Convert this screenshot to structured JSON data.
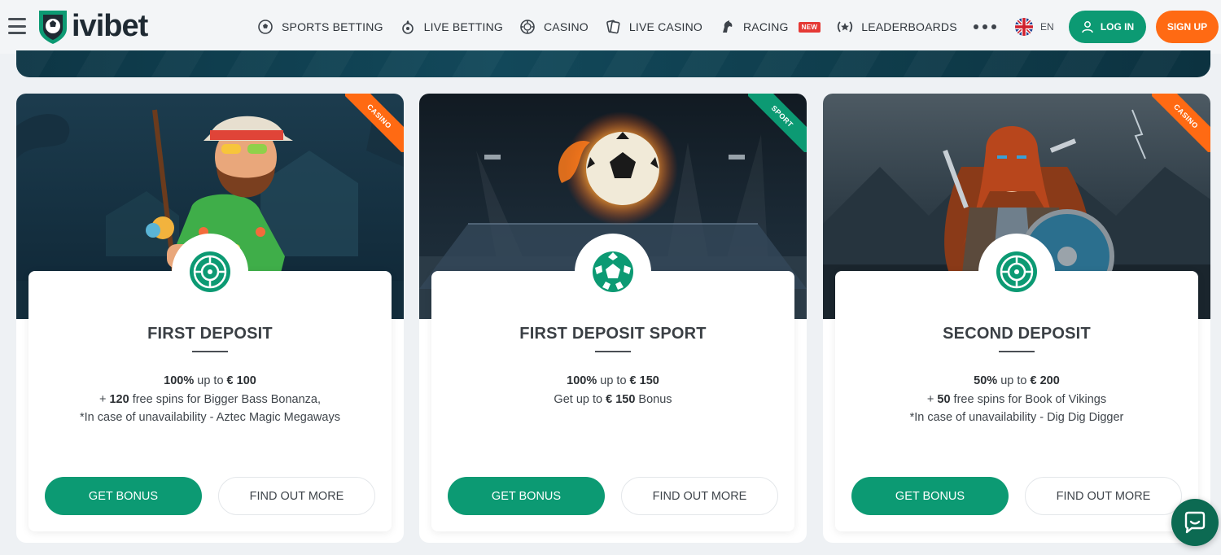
{
  "header": {
    "logo_text": "ivibet",
    "nav": [
      {
        "label": "SPORTS BETTING",
        "icon": "soccer-ball-icon"
      },
      {
        "label": "LIVE BETTING",
        "icon": "live-ball-icon"
      },
      {
        "label": "CASINO",
        "icon": "casino-chip-icon"
      },
      {
        "label": "LIVE CASINO",
        "icon": "cards-icon"
      },
      {
        "label": "RACING",
        "icon": "horse-icon",
        "badge": "NEW"
      },
      {
        "label": "LEADERBOARDS",
        "icon": "laurel-icon"
      }
    ],
    "language": "EN",
    "login_label": "LOG IN",
    "signup_label": "SIGN UP"
  },
  "colors": {
    "brand_green": "#0c9a73",
    "signup_orange": "#ff6a13",
    "ribbon_casino": "#ff6a13",
    "ribbon_sport": "#0c9a73",
    "badge_new": "#e53935"
  },
  "cards": [
    {
      "ribbon": "CASINO",
      "icon": "roulette-icon",
      "title": "FIRST DEPOSIT",
      "line1_bold_a": "100%",
      "line1_mid": " up to ",
      "line1_bold_b": "€ 100",
      "line2_prefix": "+ ",
      "line2_bold": "120",
      "line2_rest": " free spins for Bigger Bass Bonanza,",
      "line3": "*In case of unavailability - Aztec Magic Megaways",
      "bonus_label": "GET BONUS",
      "more_label": "FIND OUT MORE"
    },
    {
      "ribbon": "SPORT",
      "icon": "soccer-ball-icon",
      "title": "FIRST DEPOSIT SPORT",
      "line1_bold_a": "100%",
      "line1_mid": " up to ",
      "line1_bold_b": "€ 150",
      "line2_prefix": "Get up to ",
      "line2_bold": "€ 150",
      "line2_rest": " Bonus",
      "line3": "",
      "bonus_label": "GET BONUS",
      "more_label": "FIND OUT MORE"
    },
    {
      "ribbon": "CASINO",
      "icon": "roulette-icon",
      "title": "SECOND DEPOSIT",
      "line1_bold_a": "50%",
      "line1_mid": " up to ",
      "line1_bold_b": "€ 200",
      "line2_prefix": "+ ",
      "line2_bold": "50",
      "line2_rest": " free spins for Book of Vikings",
      "line3": "*In case of unavailability - Dig Dig Digger",
      "bonus_label": "GET BONUS",
      "more_label": "FIND OUT MORE"
    }
  ]
}
